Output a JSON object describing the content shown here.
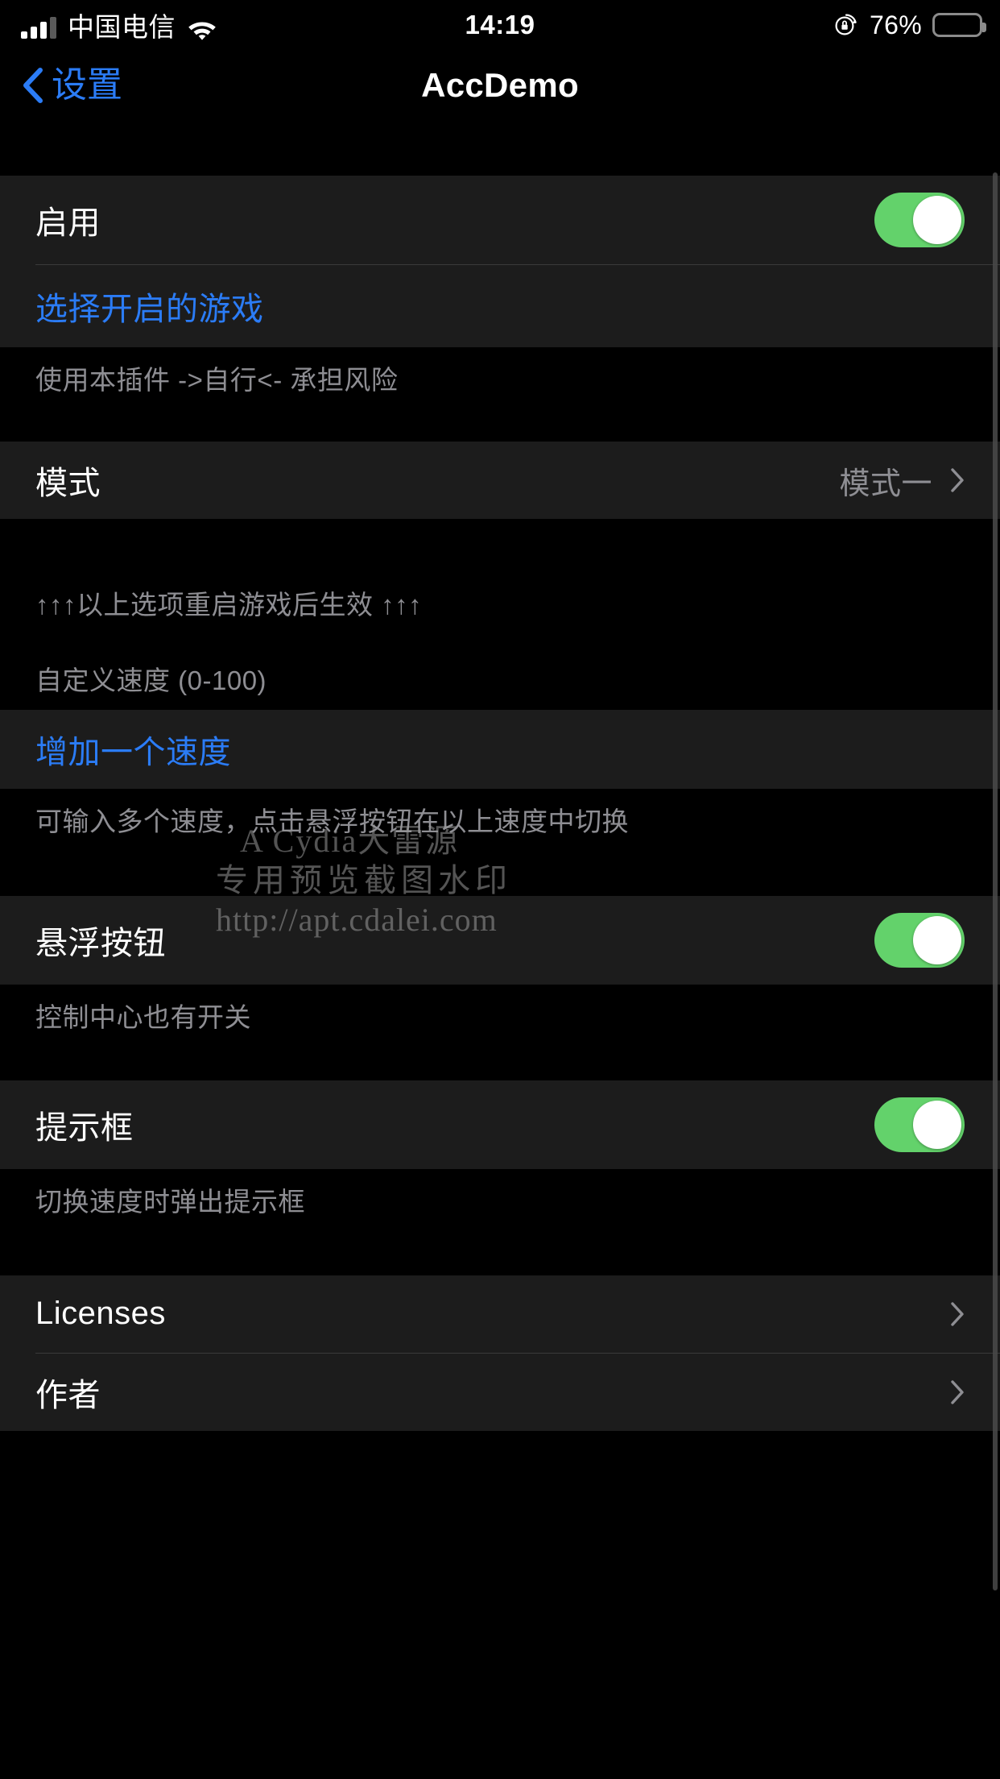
{
  "status_bar": {
    "carrier": "中国电信",
    "time": "14:19",
    "battery_percent": "76%",
    "signal_bars_filled": 3,
    "signal_bars_total": 4,
    "wifi_icon": "wifi-icon",
    "rotation_lock_icon": "rotation-lock-icon",
    "battery_icon": "battery-icon"
  },
  "nav": {
    "back_label": "设置",
    "back_icon": "chevron-left-icon",
    "title": "AccDemo"
  },
  "sections": {
    "enable_row": {
      "label": "启用",
      "toggle_state": "on"
    },
    "select_games_row": {
      "label": "选择开启的游戏"
    },
    "risk_footer": "使用本插件 ->自行<- 承担风险",
    "mode_row": {
      "label": "模式",
      "value": "模式一",
      "chevron_icon": "chevron-right-icon"
    },
    "restart_footer": "↑↑↑以上选项重启游戏后生效 ↑↑↑",
    "custom_speed_footer": "自定义速度 (0-100)",
    "add_speed_row": {
      "label": "增加一个速度"
    },
    "multi_speed_footer": "可输入多个速度，点击悬浮按钮在以上速度中切换",
    "float_button_row": {
      "label": "悬浮按钮",
      "toggle_state": "on"
    },
    "control_center_footer": "控制中心也有开关",
    "alert_box_row": {
      "label": "提示框",
      "toggle_state": "on"
    },
    "alert_footer": "切换速度时弹出提示框",
    "licenses_row": {
      "label": "Licenses",
      "chevron_icon": "chevron-right-icon"
    },
    "author_row": {
      "label": "作者",
      "chevron_icon": "chevron-right-icon"
    }
  },
  "watermark": {
    "line1": "A Cydia大雷源",
    "line2": "专用预览截图水印",
    "line3": "http://apt.cdalei.com"
  },
  "colors": {
    "accent_blue": "#2b7cf6",
    "toggle_green": "#63d26b",
    "row_background": "#1c1c1c",
    "page_background": "#000000",
    "secondary_text": "#8e8e93"
  }
}
